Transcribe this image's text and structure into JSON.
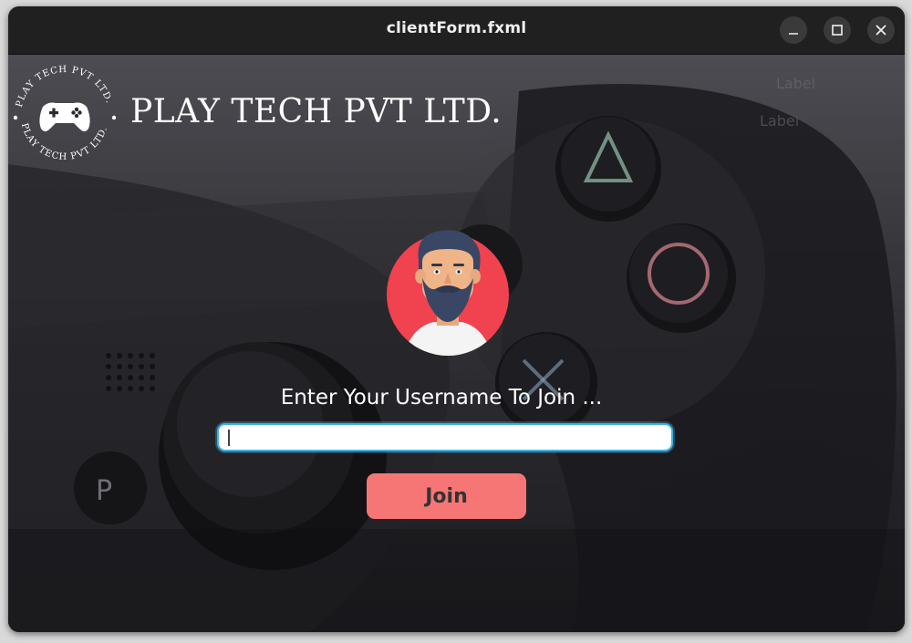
{
  "window": {
    "title": "clientForm.fxml",
    "controls": {
      "minimize_icon": "minimize-icon",
      "maximize_icon": "maximize-icon",
      "close_icon": "close-icon"
    }
  },
  "brand": {
    "name": "PLAY TECH PVT LTD.",
    "logo_ring_text": "PLAY TECH PVT LTD.",
    "logo_icon": "gamepad-icon"
  },
  "labels": {
    "label_1": "Label",
    "label_2": "Label"
  },
  "avatar": {
    "icon": "bearded-man-avatar",
    "circle_color": "#f0424f"
  },
  "form": {
    "prompt": "Enter Your Username To Join ...",
    "username_value": "",
    "username_placeholder": "",
    "join_label": "Join"
  },
  "colors": {
    "join_button": "#f67675",
    "input_focus": "#3fb4e6",
    "titlebar": "#202020"
  }
}
